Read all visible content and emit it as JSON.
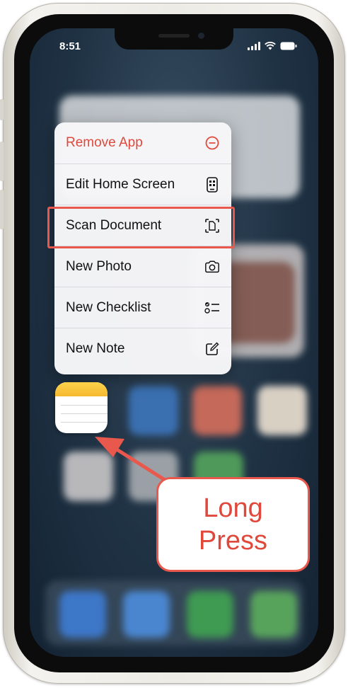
{
  "status_bar": {
    "time": "8:51",
    "signal_icon": "cellular-signal-icon",
    "wifi_icon": "wifi-icon",
    "battery_icon": "battery-icon"
  },
  "context_menu": {
    "items": [
      {
        "label": "Remove App",
        "icon": "minus-circle-icon",
        "style": "destructive"
      },
      {
        "label": "Edit Home Screen",
        "icon": "phone-apps-icon"
      },
      {
        "label": "Scan Document",
        "icon": "document-scan-icon"
      },
      {
        "label": "New Photo",
        "icon": "camera-icon"
      },
      {
        "label": "New Checklist",
        "icon": "checklist-icon"
      },
      {
        "label": "New Note",
        "icon": "compose-icon"
      }
    ]
  },
  "highlighted_item": "Scan Document",
  "app_icon": {
    "name": "notes-app-icon"
  },
  "callout": {
    "line1": "Long",
    "line2": "Press"
  },
  "colors": {
    "annotation": "#e8584c",
    "destructive": "#e0483c",
    "notes_yellow": "#f5b931"
  }
}
